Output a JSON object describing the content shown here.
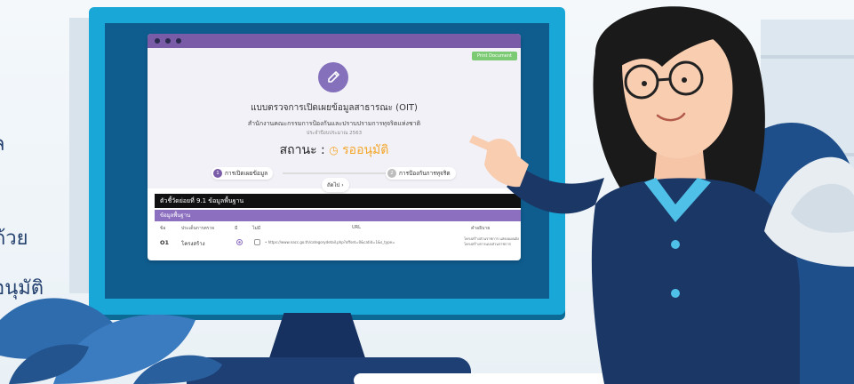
{
  "left_text": {
    "line1": "ล",
    "line2": "ด้วย",
    "line3": "อนุมัติ"
  },
  "window": {
    "print_button": "Print Document",
    "title": "แบบตรวจการเปิดเผยข้อมูลสาธารณะ (OIT)",
    "agency": "สำนักงานคณะกรรมการป้องกันและปราบปรามการทุจริตแห่งชาติ",
    "fiscal_year": "ประจำปีงบประมาณ 2563",
    "status_label": "สถานะ :",
    "status_value": "รออนุมัติ",
    "steps": [
      {
        "num": "1",
        "label": "การเปิดเผยข้อมูล"
      },
      {
        "num": "2",
        "label": "การป้องกันการทุจริต"
      }
    ],
    "next_button": "ถัดไป ›",
    "indicator": "ตัวชี้วัดย่อยที่ 9.1 ข้อมูลพื้นฐาน",
    "section": "ข้อมูลพื้นฐาน",
    "table": {
      "headers": {
        "id": "ข้อ",
        "detail": "ประเด็นการตรวจ",
        "yes": "มี",
        "no": "ไม่มี",
        "url": "URL",
        "note": "คำอธิบาย"
      },
      "rows": [
        {
          "id": "O1",
          "detail": "โครงสร้าง",
          "url": "• https://www.nacc.go.th/categorydetail.php?offset=0&catid=1&s_type=",
          "note": "โครงสร้างส่วนราชการ แสดงแผนผังโครงสร้างการแบ่งส่วนราชการ"
        }
      ]
    }
  },
  "icons": {
    "pen": "pencil-icon",
    "clock": "clock-icon"
  },
  "colors": {
    "purple": "#7a5ba8",
    "status": "#f4a62a",
    "monitor": "#19a7d7",
    "navy": "#16315f"
  }
}
